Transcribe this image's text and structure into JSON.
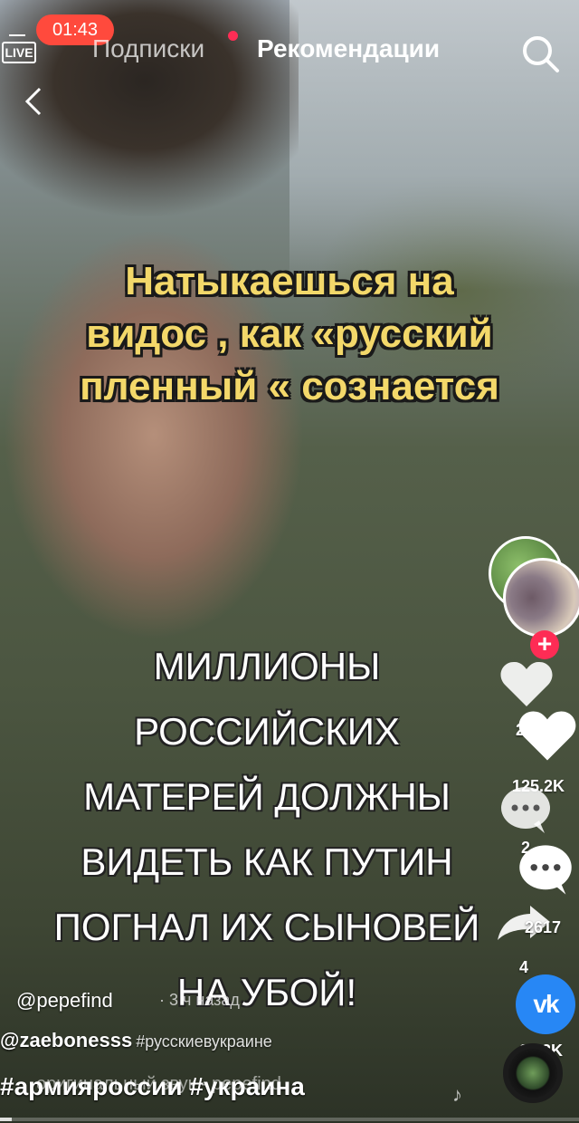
{
  "status": {
    "time": "01:43"
  },
  "header": {
    "live_label": "LIVE",
    "tab_following": "Подписки",
    "tab_for_you": "Рекомендации"
  },
  "video": {
    "caption_lines": [
      "Натыкаешься на",
      "видос , как «русский",
      "пленный « сознается"
    ],
    "subtitle_lines": [
      "МИЛЛИОНЫ",
      "РОССИЙСКИХ",
      "МАТЕРЕЙ ДОЛЖНЫ",
      "ВИДЕТЬ КАК ПУТИН",
      "ПОГНАЛ ИХ СЫНОВЕЙ",
      "НА УБОЙ!"
    ]
  },
  "rail": {
    "likes_small": "24",
    "likes": "125.2K",
    "comments_small": "2",
    "comments": "2617",
    "shares_small": "4",
    "shares": "20.3K",
    "vk_label": "vk"
  },
  "post": {
    "author": "@pepefind",
    "meta": "· 3 ч назад",
    "mention": "@zaebonesss",
    "hashtag1": "#русскиевукраине",
    "hashtags2": "#армияроссии #украина",
    "sound": "оригинальный звук - pepefind"
  },
  "progress_fraction": 0.02,
  "colors": {
    "accent": "#fe2c55",
    "caption": "#f3d86a",
    "vk": "#2787f5"
  }
}
